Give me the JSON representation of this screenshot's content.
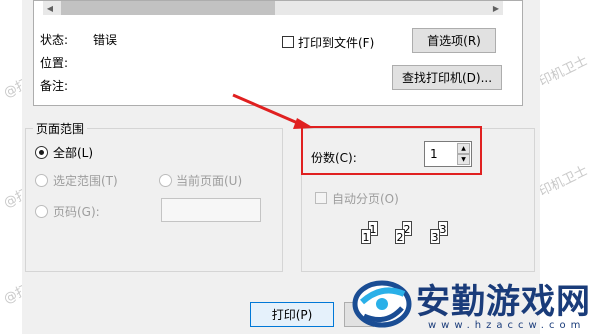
{
  "printer": {
    "status_label": "状态:",
    "status_value": "错误",
    "location_label": "位置:",
    "comment_label": "备注:",
    "print_to_file_label": "打印到文件(F)",
    "preferences_button": "首选项(R)",
    "find_printer_button": "查找打印机(D)..."
  },
  "page_range": {
    "title": "页面范围",
    "all_label": "全部(L)",
    "selection_label": "选定范围(T)",
    "current_page_label": "当前页面(U)",
    "pages_label": "页码(G):",
    "pages_value": ""
  },
  "copies": {
    "label": "份数(C):",
    "value": "1",
    "collate_label": "自动分页(O)"
  },
  "footer": {
    "print_button": "打印(P)"
  },
  "watermark": {
    "text": "@打印机卫士",
    "site_name": "安勤游戏网",
    "site_url": "www.hzaccw.com"
  },
  "annotation": {
    "arrow_color": "#e02020",
    "highlight_color": "#e02020"
  }
}
